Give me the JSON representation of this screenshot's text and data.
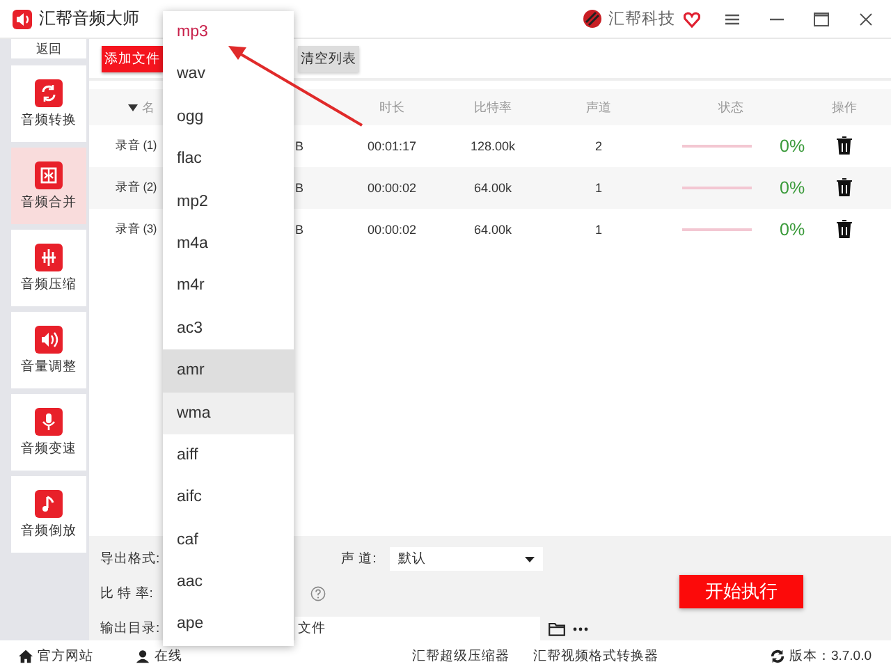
{
  "window": {
    "title": "汇帮音频大师",
    "brand": "汇帮科技"
  },
  "sidebar": {
    "back": "返回",
    "items": [
      {
        "label": "音频转换",
        "selected": false
      },
      {
        "label": "音频合并",
        "selected": true
      },
      {
        "label": "音频压缩",
        "selected": false
      },
      {
        "label": "音量调整",
        "selected": false
      },
      {
        "label": "音频变速",
        "selected": false
      },
      {
        "label": "音频倒放",
        "selected": false
      }
    ]
  },
  "toolbar": {
    "buttons": [
      {
        "label": "添加文件",
        "kind": "primary"
      },
      {
        "label": "清空列表",
        "kind": "secondary"
      }
    ]
  },
  "table": {
    "header": {
      "name": "名",
      "duration": "时长",
      "bitrate": "比特率",
      "channels": "声道",
      "status": "状态",
      "action": "操作"
    },
    "rows": [
      {
        "name": "录音 (1)",
        "column_2": "B",
        "duration": "00:01:17",
        "bitrate": "128.00k",
        "channels": "2",
        "level": 0,
        "progress": "0%"
      },
      {
        "name": "录音 (2)",
        "column_2": "B",
        "duration": "00:00:02",
        "bitrate": "64.00k",
        "channels": "1",
        "level": 0,
        "progress": "0%"
      },
      {
        "name": "录音 (3)",
        "column_2": "B",
        "duration": "00:00:02",
        "bitrate": "64.00k",
        "channels": "1",
        "level": 0,
        "progress": "0%"
      }
    ]
  },
  "settings": {
    "format_label": "导出格式:",
    "channel_label": "声 道:",
    "channel_value": "默认",
    "bitrate_label": "比 特 率:",
    "output_label": "输出目录:",
    "output_value": "文件",
    "start_button": "开始执行"
  },
  "format_menu": {
    "options": [
      {
        "label": "mp3",
        "selected": true,
        "hovered": false,
        "focused": false
      },
      {
        "label": "wav",
        "selected": false,
        "hovered": false,
        "focused": false
      },
      {
        "label": "ogg",
        "selected": false,
        "hovered": false,
        "focused": false
      },
      {
        "label": "flac",
        "selected": false,
        "hovered": false,
        "focused": false
      },
      {
        "label": "mp2",
        "selected": false,
        "hovered": false,
        "focused": false
      },
      {
        "label": "m4a",
        "selected": false,
        "hovered": false,
        "focused": false
      },
      {
        "label": "m4r",
        "selected": false,
        "hovered": false,
        "focused": false
      },
      {
        "label": "ac3",
        "selected": false,
        "hovered": false,
        "focused": false
      },
      {
        "label": "amr",
        "selected": false,
        "hovered": true,
        "focused": false
      },
      {
        "label": "wma",
        "selected": false,
        "hovered": false,
        "focused": true
      },
      {
        "label": "aiff",
        "selected": false,
        "hovered": false,
        "focused": false
      },
      {
        "label": "aifc",
        "selected": false,
        "hovered": false,
        "focused": false
      },
      {
        "label": "caf",
        "selected": false,
        "hovered": false,
        "focused": false
      },
      {
        "label": "aac",
        "selected": false,
        "hovered": false,
        "focused": false
      },
      {
        "label": "ape",
        "selected": false,
        "hovered": false,
        "focused": false
      }
    ]
  },
  "footer": {
    "left_links": [
      "官方网站",
      "在线"
    ],
    "center_links": [
      "汇帮超级压缩器",
      "汇帮视频格式转换器"
    ],
    "version": "版本：3.7.0.0"
  }
}
